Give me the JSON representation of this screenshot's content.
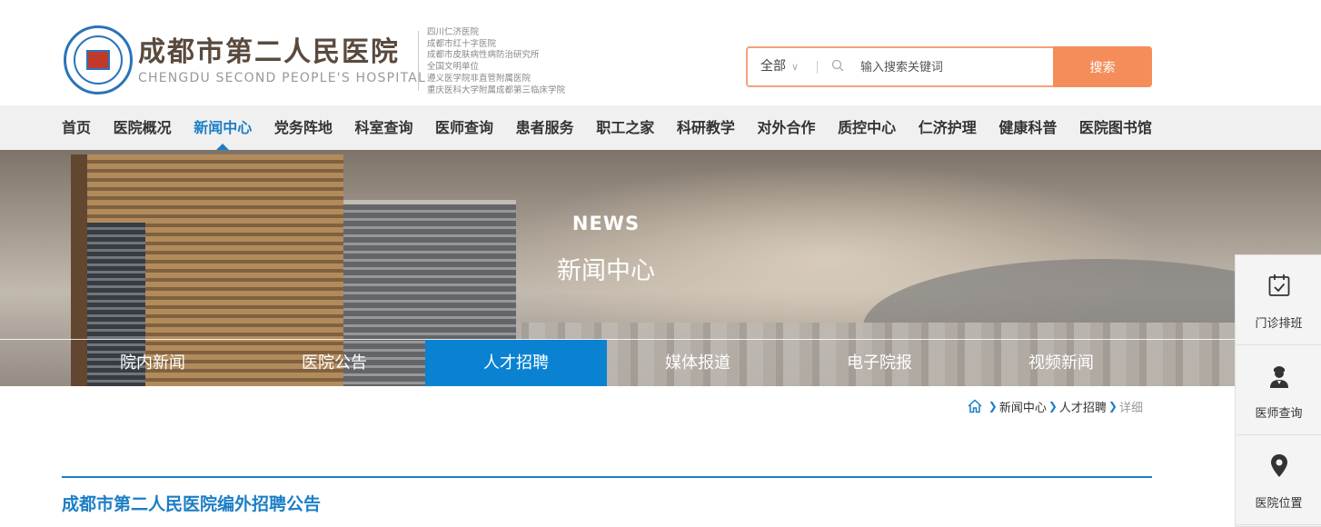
{
  "header": {
    "brand_cn": "成都市第二人民医院",
    "brand_en": "CHENGDU SECOND PEOPLE'S HOSPITAL",
    "affiliations": [
      "四川仁济医院",
      "成都市红十字医院",
      "成都市皮肤病性病防治研究所",
      "全国文明单位",
      "遵义医学院非直管附属医院",
      "重庆医科大学附属成都第三临床学院"
    ],
    "search": {
      "category": "全部",
      "placeholder": "输入搜索关键词",
      "button_label": "搜索"
    }
  },
  "nav": {
    "items": [
      "首页",
      "医院概况",
      "新闻中心",
      "党务阵地",
      "科室查询",
      "医师查询",
      "患者服务",
      "职工之家",
      "科研教学",
      "对外合作",
      "质控中心",
      "仁济护理",
      "健康科普",
      "医院图书馆"
    ],
    "active_index": 2
  },
  "banner": {
    "title_en": "NEWS",
    "title_cn": "新闻中心"
  },
  "subtabs": {
    "items": [
      "院内新闻",
      "医院公告",
      "人才招聘",
      "媒体报道",
      "电子院报",
      "视频新闻"
    ],
    "active_index": 2
  },
  "breadcrumb": {
    "items": [
      "新闻中心",
      "人才招聘",
      "详细"
    ]
  },
  "article": {
    "title": "成都市第二人民医院编外招聘公告"
  },
  "sidebar": {
    "items": [
      {
        "label": "门诊排班",
        "icon": "calendar-check-icon"
      },
      {
        "label": "医师查询",
        "icon": "doctor-icon"
      },
      {
        "label": "医院位置",
        "icon": "location-pin-icon"
      }
    ]
  },
  "colors": {
    "primary": "#1c7ec6",
    "tab_active": "#0a82d1",
    "search_accent": "#f58d5b",
    "brand_text": "#5a4a3e"
  }
}
